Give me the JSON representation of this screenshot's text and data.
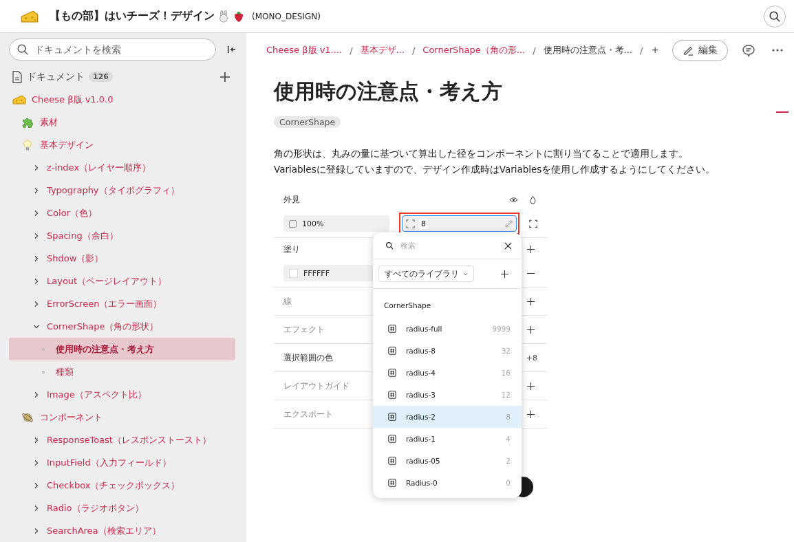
{
  "header": {
    "title": "【もの部】はいチーズ！デザイン",
    "workspace": "(MONO_DESIGN)"
  },
  "sidebar": {
    "search": {
      "placeholder": "ドキュメントを検索"
    },
    "section_title": "ドキュメント",
    "count": "126",
    "tree": [
      {
        "kind": "group",
        "label": "Cheese β版 v1.0.0",
        "children": [
          {
            "kind": "group",
            "label": "素材"
          },
          {
            "kind": "group",
            "label": "基本デザイン",
            "children": [
              {
                "kind": "section",
                "label": "z-index（レイヤー順序）",
                "expanded": false
              },
              {
                "kind": "section",
                "label": "Typography（タイポグラフィ）",
                "expanded": false
              },
              {
                "kind": "section",
                "label": "Color（色）",
                "expanded": false
              },
              {
                "kind": "section",
                "label": "Spacing（余白）",
                "expanded": false
              },
              {
                "kind": "section",
                "label": "Shdow（影）",
                "expanded": false
              },
              {
                "kind": "section",
                "label": "Layout（ページレイアウト）",
                "expanded": false
              },
              {
                "kind": "section",
                "label": "ErrorScreen（エラー画面）",
                "expanded": false
              },
              {
                "kind": "section",
                "label": "CornerShape（角の形状）",
                "expanded": true,
                "children": [
                  {
                    "kind": "page",
                    "label": "使用時の注意点・考え方",
                    "selected": true
                  },
                  {
                    "kind": "page",
                    "label": "種類",
                    "selected": false
                  }
                ]
              },
              {
                "kind": "section",
                "label": "Image（アスペクト比）",
                "expanded": false
              }
            ]
          },
          {
            "kind": "group",
            "label": "コンポーネント",
            "children": [
              {
                "kind": "section",
                "label": "ResponseToast（レスポンストースト）",
                "expanded": false
              },
              {
                "kind": "section",
                "label": "InputField（入力フィールド）",
                "expanded": false
              },
              {
                "kind": "section",
                "label": "Checkbox（チェックボックス）",
                "expanded": false
              },
              {
                "kind": "section",
                "label": "Radio（ラジオボタン）",
                "expanded": false
              },
              {
                "kind": "section",
                "label": "SearchArea（検索エリア）",
                "expanded": false
              }
            ]
          }
        ]
      }
    ]
  },
  "breadcrumb": [
    {
      "kind": "link",
      "label": "Cheese β版 v1...."
    },
    {
      "kind": "separator",
      "label": "/"
    },
    {
      "kind": "link",
      "label": "基本デザ..."
    },
    {
      "kind": "separator",
      "label": "/"
    },
    {
      "kind": "link",
      "label": "CornerShape（角の形..."
    },
    {
      "kind": "separator",
      "label": "/"
    },
    {
      "kind": "current",
      "label": "使用時の注意点・考..."
    },
    {
      "kind": "separator",
      "label": "/"
    },
    {
      "kind": "add",
      "label": "+"
    }
  ],
  "edit_button": "編集",
  "page": {
    "title": "使用時の注意点・考え方",
    "tag": "CornerShape",
    "paragraphs": [
      "角の形状は、丸みの量に基づいて算出した径をコンポーネントに割り当てることで適用します。",
      "Variablesに登録していますので、デザイン作成時はVariablesを使用し作成するようにしてください。"
    ]
  },
  "design_panel": {
    "appearance": {
      "title": "外見",
      "opacity": "100%",
      "radius": "8",
      "radius_highlighted": true
    },
    "fill": {
      "title": "塗り",
      "hex": "FFFFFF"
    },
    "sections": [
      {
        "title": "線",
        "muted": true
      },
      {
        "title": "エフェクト",
        "muted": true
      },
      {
        "title": "選択範囲の色",
        "muted": false,
        "value": "+8"
      },
      {
        "title": "レイアウトガイド",
        "muted": true
      },
      {
        "title": "エクスポート",
        "muted": true
      }
    ],
    "popup": {
      "search_placeholder": "検索",
      "library": "すべてのライブラリ",
      "group": "CornerShape",
      "variables": [
        {
          "name": "radius-full",
          "value": "9999",
          "selected": false
        },
        {
          "name": "radius-8",
          "value": "32",
          "selected": false
        },
        {
          "name": "radius-4",
          "value": "16",
          "selected": false
        },
        {
          "name": "radius-3",
          "value": "12",
          "selected": false
        },
        {
          "name": "radius-2",
          "value": "8",
          "selected": true
        },
        {
          "name": "radius-1",
          "value": "4",
          "selected": false
        },
        {
          "name": "radius-05",
          "value": "2",
          "selected": false
        },
        {
          "name": "Radius-0",
          "value": "0",
          "selected": false
        }
      ]
    }
  }
}
